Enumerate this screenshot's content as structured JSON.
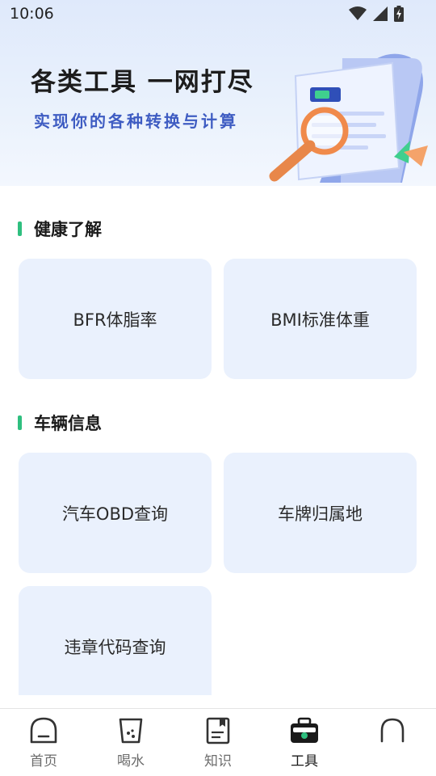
{
  "status_bar": {
    "time": "10:06",
    "icons": [
      "wifi-icon",
      "signal-icon",
      "battery-charging-icon"
    ]
  },
  "hero": {
    "title": "各类工具 一网打尽",
    "subtitle": "实现你的各种转换与计算",
    "illustration": "magnifier-document-illustration"
  },
  "sections": [
    {
      "title": "健康了解",
      "tools": [
        "BFR体脂率",
        "BMI标准体重"
      ]
    },
    {
      "title": "车辆信息",
      "tools": [
        "汽车OBD查询",
        "车牌归属地",
        "违章代码查询"
      ]
    }
  ],
  "tabbar": {
    "items": [
      {
        "label": "首页",
        "icon": "home-icon"
      },
      {
        "label": "喝水",
        "icon": "water-cup-icon"
      },
      {
        "label": "知识",
        "icon": "book-icon"
      },
      {
        "label": "工具",
        "icon": "toolbox-icon",
        "active": true
      },
      {
        "label": "",
        "icon": "profile-icon"
      }
    ]
  },
  "colors": {
    "accent": "#2fbf7f",
    "tile_bg": "#eaf1fd",
    "subtitle": "#3e5cc2"
  }
}
